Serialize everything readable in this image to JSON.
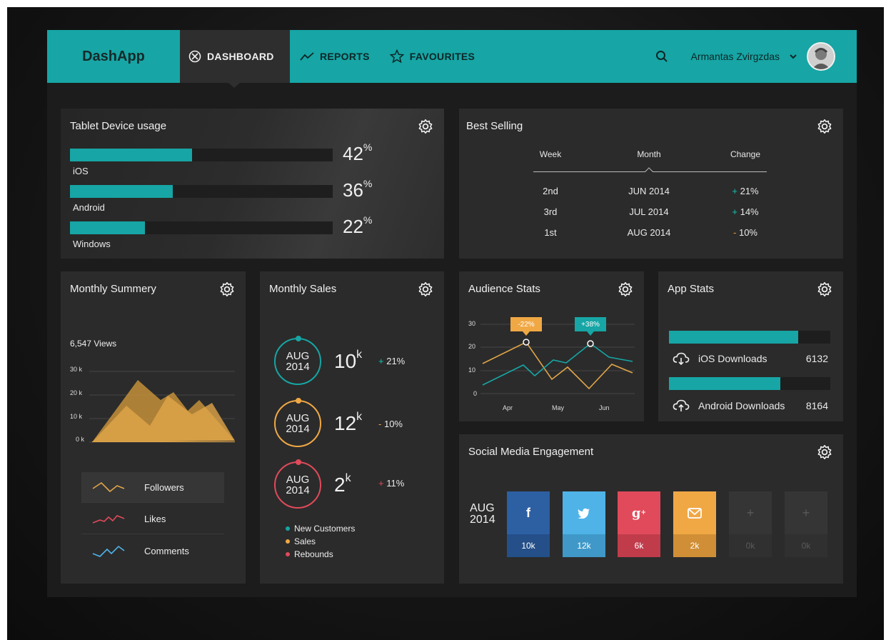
{
  "nav": {
    "brand": "DashApp",
    "items": [
      {
        "label": "DASHBOARD",
        "icon": "compass-icon"
      },
      {
        "label": "REPORTS",
        "icon": "trend-icon"
      },
      {
        "label": "FAVOURITES",
        "icon": "star-icon"
      }
    ],
    "user": "Armantas Zvirgzdas"
  },
  "tablet": {
    "title": "Tablet Device usage",
    "rows": [
      {
        "label": "iOS",
        "percent": "42",
        "fill": 0.465
      },
      {
        "label": "Android",
        "percent": "36",
        "fill": 0.39
      },
      {
        "label": "Windows",
        "percent": "22",
        "fill": 0.285
      }
    ],
    "pct_sign": "%"
  },
  "best": {
    "title": "Best Selling",
    "headers": [
      "Week",
      "Month",
      "Change"
    ],
    "rows": [
      {
        "week": "2nd",
        "month": "JUN 2014",
        "sign": "+",
        "change": "21%",
        "dir": "up"
      },
      {
        "week": "3rd",
        "month": "JUL 2014",
        "sign": "+",
        "change": "14%",
        "dir": "up"
      },
      {
        "week": "1st",
        "month": "AUG 2014",
        "sign": "-",
        "change": "10%",
        "dir": "down"
      }
    ]
  },
  "summary": {
    "title": "Monthly Summery",
    "views": "6,547 Views",
    "yticks": [
      "30 k",
      "20 k",
      "10 k",
      "0 k"
    ],
    "legend": [
      "Followers",
      "Likes",
      "Comments"
    ]
  },
  "sales": {
    "title": "Monthly Sales",
    "items": [
      {
        "month": "AUG",
        "year": "2014",
        "value": "10",
        "unit": "k",
        "sign": "+",
        "change": "21%",
        "color": "#17a5a5"
      },
      {
        "month": "AUG",
        "year": "2014",
        "value": "12",
        "unit": "k",
        "sign": "-",
        "change": "10%",
        "color": "#f0a845"
      },
      {
        "month": "AUG",
        "year": "2014",
        "value": "2",
        "unit": "k",
        "sign": "+",
        "change": "11%",
        "color": "#e04a5a"
      }
    ],
    "legend": [
      "New Customers",
      "Sales",
      "Rebounds"
    ]
  },
  "audience": {
    "title": "Audience Stats",
    "yticks": [
      "30",
      "20",
      "10",
      "0"
    ],
    "xticks": [
      "Apr",
      "May",
      "Jun"
    ],
    "tag_orange": "-22%",
    "tag_teal": "+38%"
  },
  "appstats": {
    "title": "App Stats",
    "rows": [
      {
        "label": "iOS Downloads",
        "value": "6132",
        "fill": 0.8
      },
      {
        "label": "Android Downloads",
        "value": "8164",
        "fill": 0.69
      }
    ]
  },
  "social": {
    "title": "Social Media Engagement",
    "month": "AUG",
    "year": "2014",
    "tiles": [
      {
        "icon": "f",
        "value": "10k",
        "top": "#2d5fa3",
        "bot": "#244f88"
      },
      {
        "icon": "twitter",
        "value": "12k",
        "top": "#4fb3e8",
        "bot": "#3f98c8"
      },
      {
        "icon": "g+",
        "value": "6k",
        "top": "#e04a5a",
        "bot": "#c03c4b"
      },
      {
        "icon": "mail",
        "value": "2k",
        "top": "#f0a845",
        "bot": "#d08f36"
      },
      {
        "icon": "+",
        "value": "0k",
        "top": "#353535",
        "bot": "#303030"
      },
      {
        "icon": "+",
        "value": "0k",
        "top": "#353535",
        "bot": "#303030"
      }
    ]
  }
}
